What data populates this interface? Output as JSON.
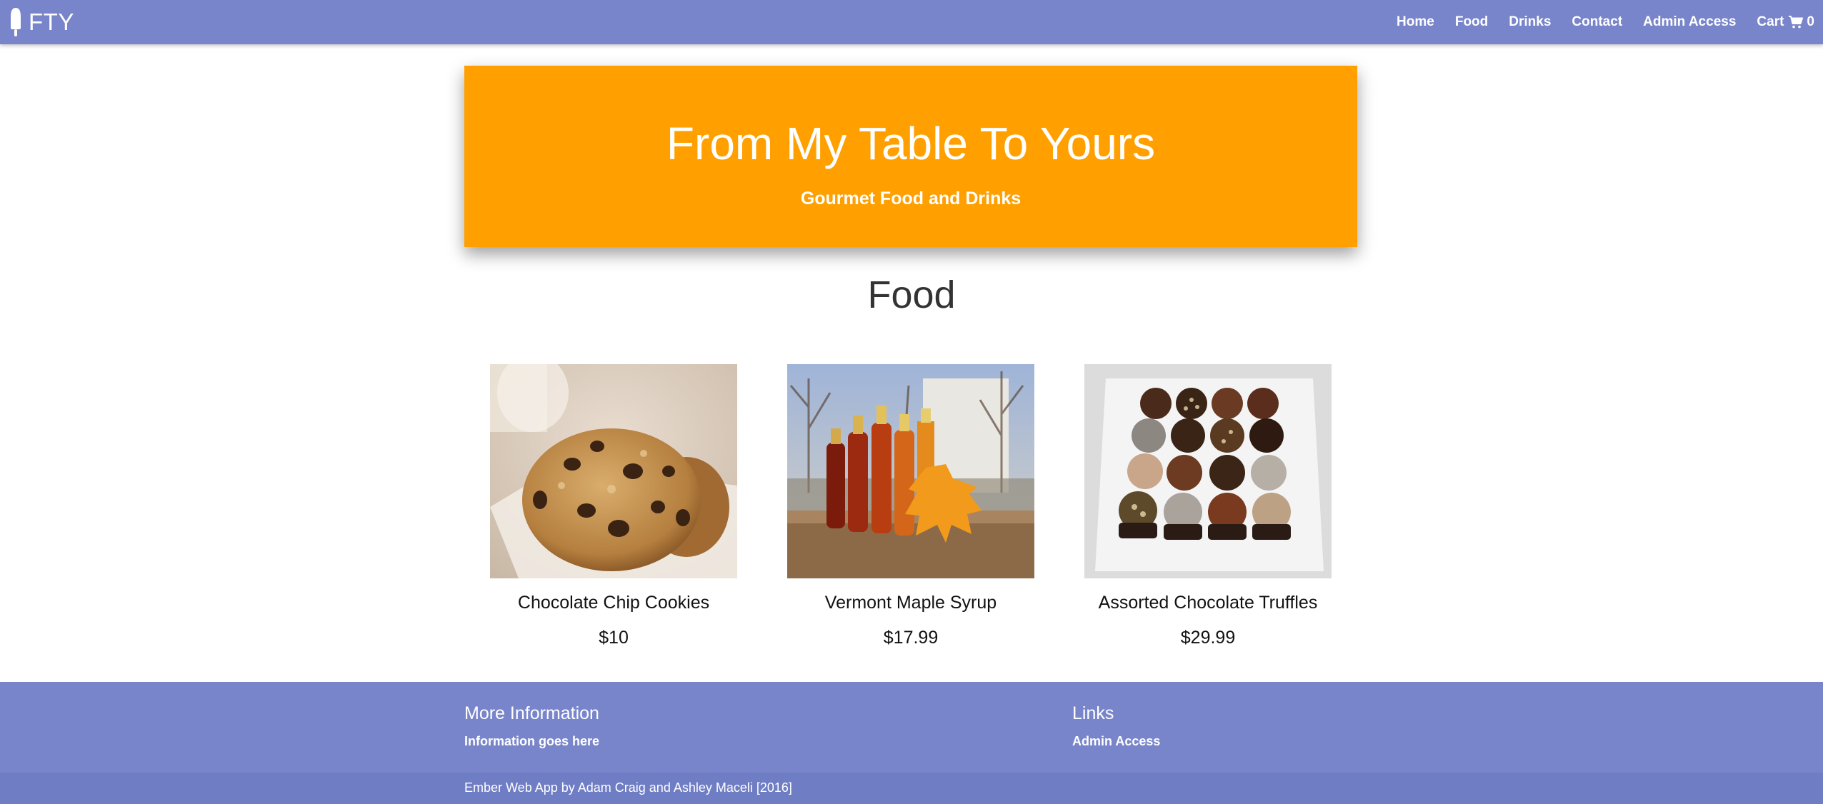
{
  "navbar": {
    "brand": "FTY",
    "brand_icon": "popsicle-icon",
    "links": {
      "home": "Home",
      "food": "Food",
      "drinks": "Drinks",
      "contact": "Contact",
      "admin": "Admin Access",
      "cart": "Cart",
      "cart_count": "0"
    },
    "cart_icon": "cart-icon"
  },
  "hero": {
    "title": "From My Table To Yours",
    "subtitle": "Gourmet Food and Drinks"
  },
  "section": {
    "title": "Food"
  },
  "products": [
    {
      "name": "Chocolate Chip Cookies",
      "price": "$10",
      "image": "cookies-photo"
    },
    {
      "name": "Vermont Maple Syrup",
      "price": "$17.99",
      "image": "maple-syrup-bottles-photo"
    },
    {
      "name": "Assorted Chocolate Truffles",
      "price": "$29.99",
      "image": "truffles-photo"
    }
  ],
  "footer": {
    "more_info_heading": "More Information",
    "more_info_text": "Information goes here",
    "links_heading": "Links",
    "links_admin": "Admin Access",
    "copyright": "Ember Web App by Adam Craig and Ashley Maceli [2016]"
  },
  "colors": {
    "primary": "#7885cb",
    "accent": "#ffa000",
    "footer_bottom": "#6f7dc4"
  }
}
